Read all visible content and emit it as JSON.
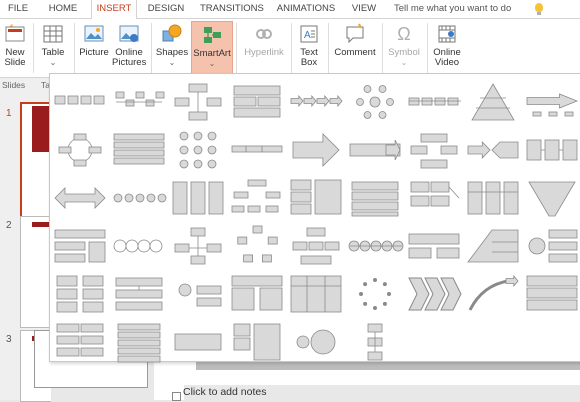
{
  "tabs": [
    "FILE",
    "HOME",
    "INSERT",
    "DESIGN",
    "TRANSITIONS",
    "ANIMATIONS",
    "VIEW"
  ],
  "active_tab": "INSERT",
  "tell_me": "Tell me what you want to do",
  "ribbon": {
    "new_slide": "New\nSlide",
    "table": "Table",
    "picture": "Picture",
    "online_pictures": "Online\nPictures",
    "shapes": "Shapes",
    "smartart": "SmartArt",
    "hyperlink": "Hyperlink",
    "text_box": "Text\nBox",
    "comment": "Comment",
    "symbol": "Symbol",
    "online_video": "Online\nVideo",
    "group_slides": "Slides",
    "group_tables": "Ta"
  },
  "slides": [
    {
      "number": "1"
    },
    {
      "number": "2"
    },
    {
      "number": "3"
    }
  ],
  "notes_placeholder": "Click to add notes",
  "colors": {
    "accent": "#c43e1c",
    "highlight": "#f5c2ad",
    "slide_red": "#9b1c1c"
  },
  "gallery": {
    "rows": 6,
    "columns": 9,
    "last_row_count": 6,
    "item_kind": "smartart-layout-icon"
  }
}
